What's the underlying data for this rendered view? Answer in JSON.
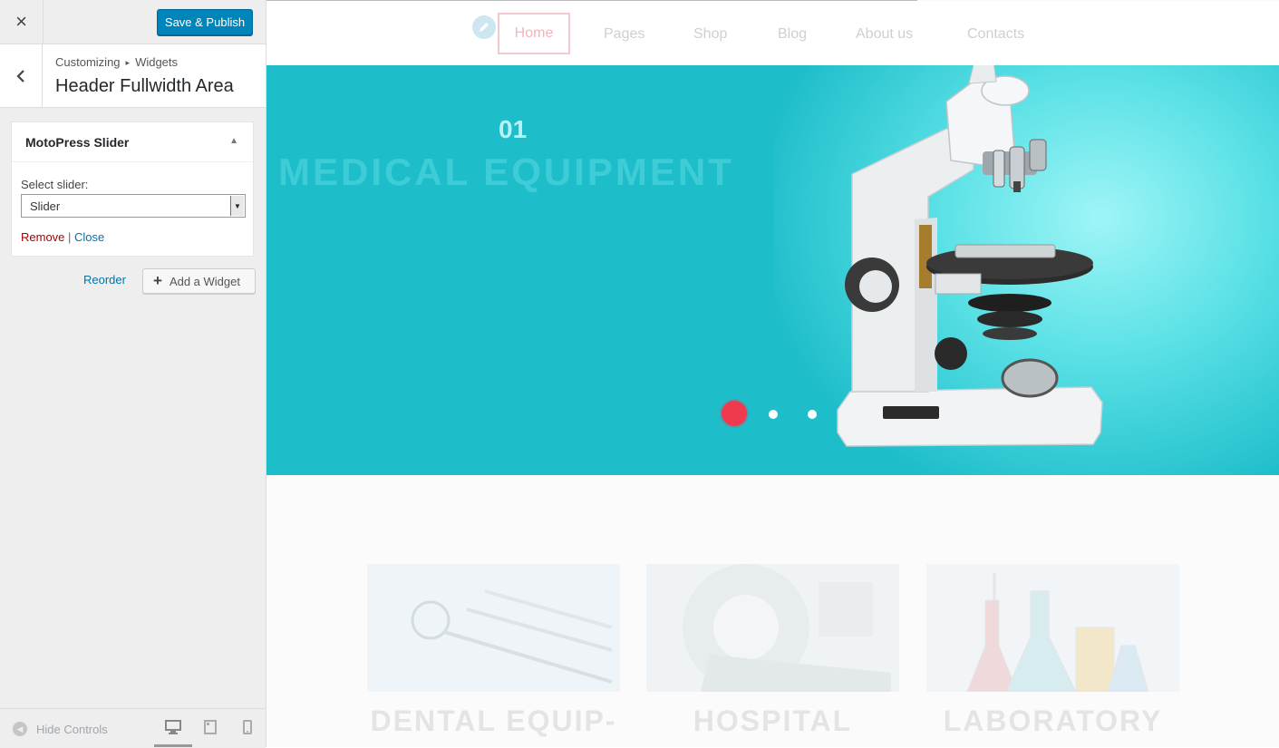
{
  "topbar": {
    "close_glyph": "×",
    "save_label": "Save & Publish"
  },
  "section": {
    "breadcrumb_parent": "Customizing",
    "breadcrumb_separator": "▸",
    "breadcrumb_child": "Widgets",
    "title": "Header Fullwidth Area"
  },
  "widget": {
    "title": "MotoPress Slider",
    "toggle_glyph": "▲",
    "select_label": "Select slider:",
    "select_value": "Slider",
    "remove_label": "Remove",
    "separator": " | ",
    "close_label": "Close"
  },
  "actions": {
    "reorder_label": "Reorder",
    "add_widget_label": "Add a Widget",
    "add_glyph": "+"
  },
  "footer": {
    "hide_controls_label": "Hide Controls"
  },
  "preview": {
    "nav": [
      "Home",
      "Pages",
      "Shop",
      "Blog",
      "About us",
      "Contacts"
    ],
    "slide_number": "01",
    "slide_title": "MEDICAL EQUIPMENT",
    "active_slide": 1,
    "slide_count": 3,
    "cards": [
      "DENTAL EQUIP-",
      "HOSPITAL",
      "LABORATORY"
    ]
  },
  "colors": {
    "primary_button": "#0085ba",
    "hero_background": "#1ebdca",
    "active_dot": "#f0384e",
    "remove_link": "#aa0000",
    "link": "#0073aa"
  },
  "icons": [
    "close-icon",
    "back-arrow-icon",
    "triangle-up-icon",
    "dropdown-arrow-icon",
    "plus-icon",
    "hide-controls-icon",
    "desktop-icon",
    "tablet-icon",
    "mobile-icon",
    "pencil-icon",
    "microscope-image"
  ]
}
